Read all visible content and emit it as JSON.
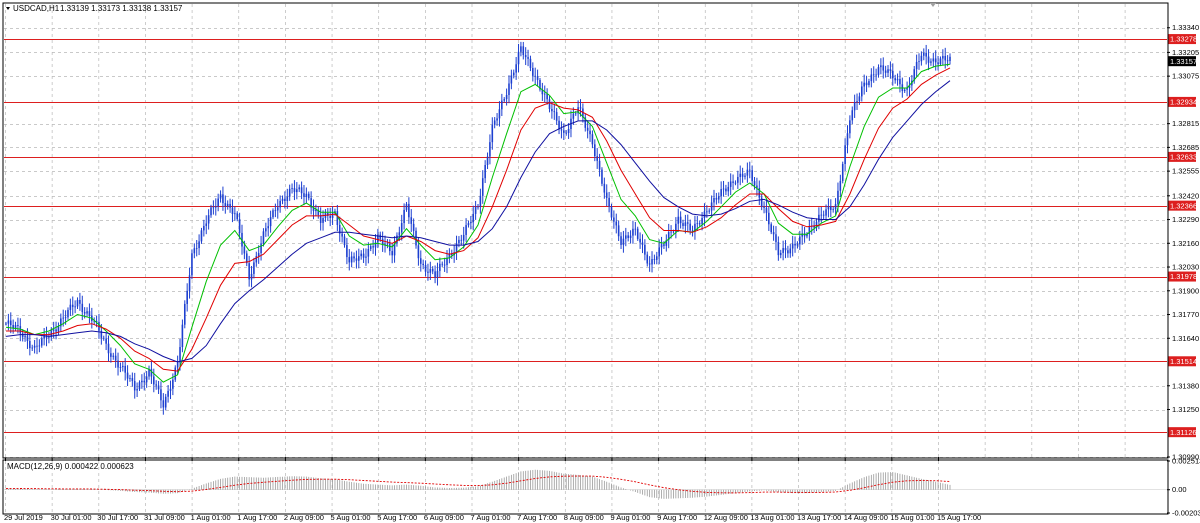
{
  "header": {
    "symbol": "USDCAD,H1",
    "ohlc": "1.33139 1.33173 1.33138 1.33157"
  },
  "macd_header": {
    "label": "MACD(12,26,9) 0.000422 0.000623"
  },
  "colors": {
    "candles": "#1c3fd0",
    "ma_fast": "#00c000",
    "ma_mid": "#e00000",
    "ma_slow": "#1010a0",
    "hlines": "#dd1f1f",
    "grid": "#b8b8b8",
    "macd_hist": "#9a9a9a",
    "macd_signal": "#e00000",
    "current_tag_bg": "#000000"
  },
  "chart_data": [
    {
      "type": "candlestick",
      "title": "USDCAD,H1",
      "ylim": [
        1.3099,
        1.3347
      ],
      "y_ticks": [
        "1.33340",
        "1.33205",
        "1.33075",
        "1.32815",
        "1.32685",
        "1.32555",
        "1.32420",
        "1.32290",
        "1.32160",
        "1.32030",
        "1.31900",
        "1.31770",
        "1.31640",
        "1.31380",
        "1.31250",
        "1.30990"
      ],
      "x_ticks": [
        "29 Jul 2019",
        "30 Jul 01:00",
        "30 Jul 17:00",
        "31 Jul 09:00",
        "1 Aug 01:00",
        "1 Aug 17:00",
        "2 Aug 09:00",
        "5 Aug 01:00",
        "5 Aug 17:00",
        "6 Aug 09:00",
        "7 Aug 01:00",
        "7 Aug 17:00",
        "8 Aug 09:00",
        "9 Aug 01:00",
        "9 Aug 17:00",
        "12 Aug 09:00",
        "13 Aug 01:00",
        "13 Aug 17:00",
        "14 Aug 09:00",
        "15 Aug 01:00",
        "15 Aug 17:00"
      ],
      "horizontal_levels": [
        "1.33278",
        "1.32934",
        "1.32633",
        "1.32366",
        "1.31978",
        "1.31514",
        "1.31126"
      ],
      "current_price": "1.33157",
      "series": [
        {
          "style": "close",
          "values": [
            1.3172,
            1.3168,
            1.3158,
            1.3166,
            1.3175,
            1.3184,
            1.3175,
            1.316,
            1.3148,
            1.3137,
            1.3145,
            1.3128,
            1.315,
            1.321,
            1.3228,
            1.3242,
            1.3232,
            1.3198,
            1.322,
            1.3238,
            1.3245,
            1.3243,
            1.3228,
            1.3233,
            1.3205,
            1.321,
            1.3218,
            1.3212,
            1.3236,
            1.3205,
            1.3198,
            1.321,
            1.322,
            1.3238,
            1.3278,
            1.33,
            1.3322,
            1.3308,
            1.329,
            1.3276,
            1.329,
            1.3272,
            1.3238,
            1.3218,
            1.3222,
            1.3205,
            1.3215,
            1.323,
            1.3222,
            1.3235,
            1.3243,
            1.3252,
            1.3254,
            1.3236,
            1.321,
            1.3215,
            1.3221,
            1.3233,
            1.3235,
            1.3286,
            1.3302,
            1.3313,
            1.3307,
            1.33,
            1.3319,
            1.3316,
            1.3316
          ]
        },
        {
          "style": "ma_fast",
          "values": [
            1.317,
            1.3169,
            1.3166,
            1.3168,
            1.3172,
            1.3177,
            1.3175,
            1.3168,
            1.316,
            1.315,
            1.3147,
            1.314,
            1.3144,
            1.317,
            1.3195,
            1.3215,
            1.3223,
            1.3212,
            1.3215,
            1.3225,
            1.3234,
            1.3238,
            1.3233,
            1.3233,
            1.322,
            1.3215,
            1.3216,
            1.3214,
            1.3224,
            1.3215,
            1.3207,
            1.3208,
            1.3214,
            1.3226,
            1.3252,
            1.3276,
            1.3299,
            1.3303,
            1.3297,
            1.3287,
            1.3288,
            1.328,
            1.326,
            1.324,
            1.3231,
            1.3218,
            1.3216,
            1.3223,
            1.3222,
            1.3228,
            1.3236,
            1.3244,
            1.3249,
            1.3243,
            1.3227,
            1.3221,
            1.3221,
            1.3227,
            1.3231,
            1.3258,
            1.328,
            1.3296,
            1.3301,
            1.3301,
            1.331,
            1.3313,
            1.3314
          ]
        },
        {
          "style": "ma_mid",
          "values": [
            1.3168,
            1.3168,
            1.3166,
            1.3166,
            1.3168,
            1.3171,
            1.3172,
            1.3169,
            1.3164,
            1.3157,
            1.3153,
            1.3147,
            1.3146,
            1.3158,
            1.3175,
            1.3193,
            1.3205,
            1.3206,
            1.321,
            1.3218,
            1.3226,
            1.3231,
            1.3231,
            1.3232,
            1.3226,
            1.322,
            1.3218,
            1.3216,
            1.322,
            1.3217,
            1.3212,
            1.321,
            1.3212,
            1.3219,
            1.3236,
            1.3256,
            1.3278,
            1.329,
            1.3293,
            1.329,
            1.3289,
            1.3285,
            1.3272,
            1.3256,
            1.3243,
            1.323,
            1.3223,
            1.3223,
            1.3222,
            1.3225,
            1.323,
            1.3237,
            1.3243,
            1.3243,
            1.3235,
            1.3228,
            1.3225,
            1.3226,
            1.3228,
            1.3243,
            1.3262,
            1.3279,
            1.329,
            1.3295,
            1.3303,
            1.3308,
            1.3312
          ]
        },
        {
          "style": "ma_slow",
          "values": [
            1.3165,
            1.3166,
            1.3166,
            1.3165,
            1.3166,
            1.3167,
            1.3168,
            1.3167,
            1.3165,
            1.3161,
            1.3158,
            1.3154,
            1.3151,
            1.3153,
            1.316,
            1.3172,
            1.3183,
            1.319,
            1.3196,
            1.3203,
            1.321,
            1.3216,
            1.3219,
            1.3222,
            1.3222,
            1.3221,
            1.322,
            1.3219,
            1.322,
            1.3219,
            1.3217,
            1.3215,
            1.3215,
            1.3217,
            1.3224,
            1.3236,
            1.3252,
            1.3266,
            1.3276,
            1.328,
            1.3283,
            1.3283,
            1.3278,
            1.327,
            1.326,
            1.325,
            1.3241,
            1.3236,
            1.3232,
            1.3231,
            1.3232,
            1.3235,
            1.3239,
            1.324,
            1.3237,
            1.3233,
            1.323,
            1.3229,
            1.3229,
            1.3236,
            1.3248,
            1.3262,
            1.3274,
            1.3283,
            1.3292,
            1.3299,
            1.3305
          ]
        }
      ]
    },
    {
      "type": "bar",
      "title": "MACD(12,26,9) 0.000422 0.000623",
      "ylim": [
        -0.002036,
        0.002513
      ],
      "y_ticks": [
        "0.002513",
        "0.00",
        "-0.002036"
      ],
      "series": [
        {
          "name": "MACD",
          "values": [
            0.0001,
            8e-05,
            5e-05,
            3e-05,
            4e-05,
            6e-05,
            4e-05,
            -2e-05,
            -0.0001,
            -0.0002,
            -0.00025,
            -0.00035,
            -0.0003,
            0.0001,
            0.00055,
            0.00095,
            0.00115,
            0.0011,
            0.00105,
            0.00112,
            0.00118,
            0.00115,
            0.001,
            0.00092,
            0.0007,
            0.00052,
            0.00045,
            0.00038,
            0.00045,
            0.00035,
            0.0002,
            0.00015,
            0.00018,
            0.0003,
            0.0007,
            0.00115,
            0.0016,
            0.00175,
            0.00165,
            0.0014,
            0.0013,
            0.00115,
            0.0007,
            0.0002,
            -0.0002,
            -0.00065,
            -0.0008,
            -0.00075,
            -0.0007,
            -0.0006,
            -0.00045,
            -0.0003,
            -0.00015,
            -5e-05,
            -0.0002,
            -0.0003,
            -0.0003,
            -0.0002,
            -0.0001,
            0.00055,
            0.0011,
            0.0015,
            0.00155,
            0.00125,
            0.00095,
            0.0007,
            0.00042
          ]
        },
        {
          "name": "Signal",
          "style": "dashed",
          "values": [
            0.00012,
            0.00011,
            0.0001,
            8e-05,
            7e-05,
            7e-05,
            6e-05,
            4e-05,
            1e-05,
            -4e-05,
            -8e-05,
            -0.00014,
            -0.00017,
            -0.00012,
            2e-05,
            0.0002,
            0.0004,
            0.00055,
            0.00065,
            0.00075,
            0.00083,
            0.0009,
            0.00092,
            0.00092,
            0.00088,
            0.00081,
            0.00074,
            0.00067,
            0.00062,
            0.00057,
            0.0005,
            0.00043,
            0.00038,
            0.00036,
            0.00043,
            0.00057,
            0.00078,
            0.00098,
            0.00112,
            0.00118,
            0.0012,
            0.00119,
            0.00109,
            0.00091,
            0.00069,
            0.00042,
            0.00018,
            0.0,
            -0.00014,
            -0.00023,
            -0.00027,
            -0.00028,
            -0.00025,
            -0.00021,
            -0.00021,
            -0.00023,
            -0.00024,
            -0.00023,
            -0.0002,
            -5e-05,
            0.00018,
            0.00044,
            0.00066,
            0.00078,
            0.00081,
            0.00079,
            0.00072
          ]
        }
      ]
    }
  ]
}
